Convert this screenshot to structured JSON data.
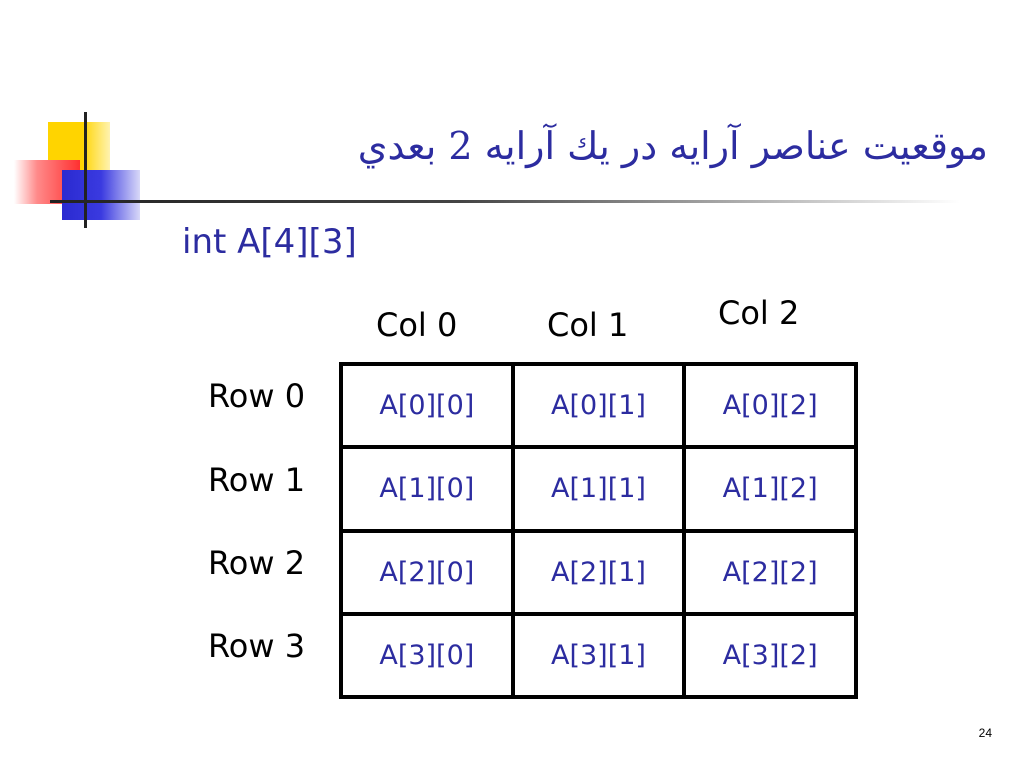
{
  "slide": {
    "title": "موقعيت عناصر آرايه در يك آرايه 2 بعدي",
    "declaration": "int A[4][3]",
    "page_number": "24"
  },
  "table": {
    "col_headers": [
      "Col 0",
      "Col 1",
      "Col 2"
    ],
    "row_headers": [
      "Row 0",
      "Row 1",
      "Row 2",
      "Row 3"
    ],
    "cells": [
      [
        "A[0][0]",
        "A[0][1]",
        "A[0][2]"
      ],
      [
        "A[1][0]",
        "A[1][1]",
        "A[1][2]"
      ],
      [
        "A[2][0]",
        "A[2][1]",
        "A[2][2]"
      ],
      [
        "A[3][0]",
        "A[3][1]",
        "A[3][2]"
      ]
    ]
  },
  "colors": {
    "title_text": "#2c2ca0",
    "cell_text": "#2c2ca0",
    "grid_border": "#000000"
  }
}
